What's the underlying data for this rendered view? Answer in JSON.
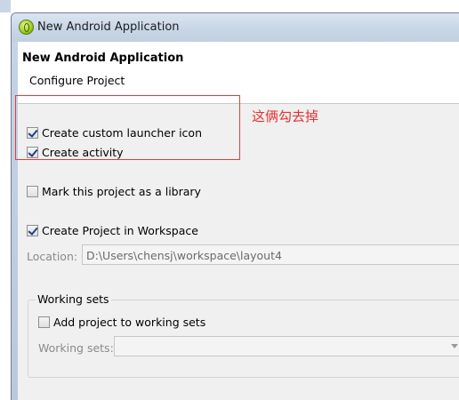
{
  "window": {
    "title": "New Android Application"
  },
  "header": {
    "title": "New Android Application",
    "subtitle": "Configure Project"
  },
  "options": {
    "custom_launcher_icon": {
      "label": "Create custom launcher icon",
      "checked": true
    },
    "create_activity": {
      "label": "Create activity",
      "checked": true
    },
    "mark_library": {
      "label": "Mark this project as a library",
      "checked": false
    },
    "create_in_workspace": {
      "label": "Create Project in Workspace",
      "checked": true
    }
  },
  "location": {
    "label": "Location:",
    "value": "D:\\Users\\chensj\\workspace\\layout4"
  },
  "working_sets": {
    "group_label": "Working sets",
    "add_label": "Add project to working sets",
    "add_checked": false,
    "combo_label": "Working sets:",
    "combo_value": ""
  },
  "annotation": {
    "text": "这俩勾去掉",
    "color": "#e8302f"
  }
}
